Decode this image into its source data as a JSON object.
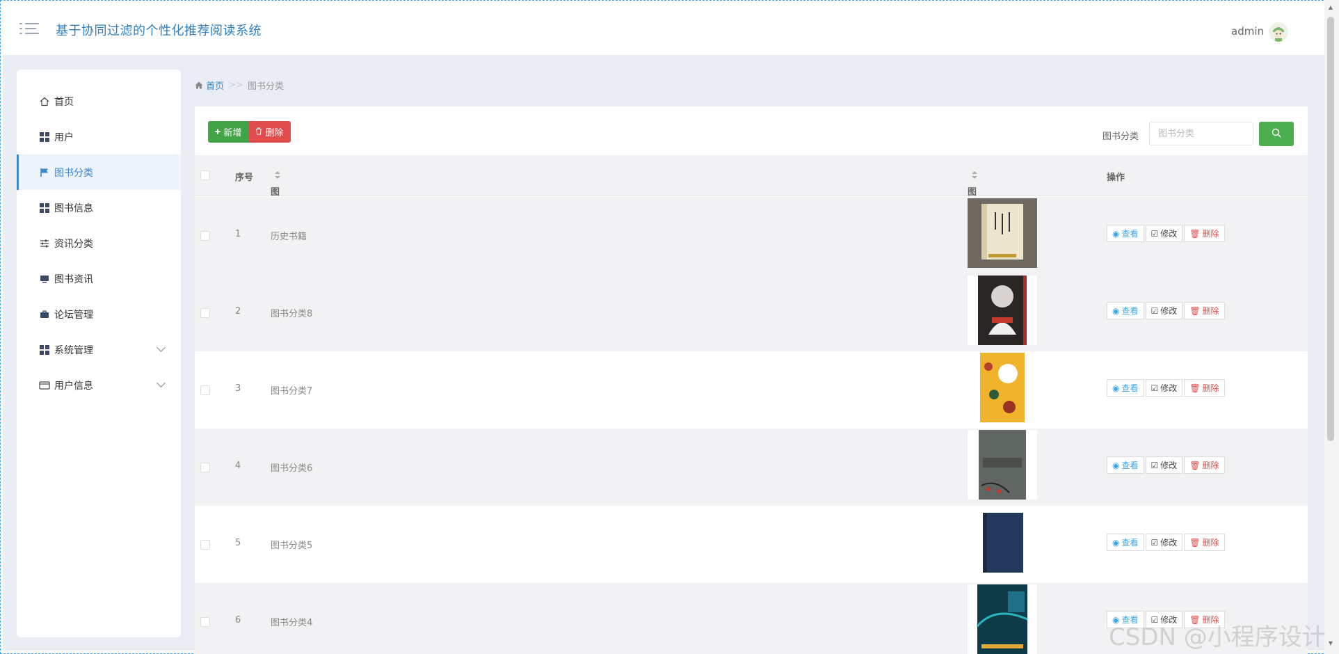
{
  "header": {
    "app_title": "基于协同过滤的个性化推荐阅读系统",
    "user_name": "admin",
    "menu_icon": "list-menu-icon",
    "avatar_icon": "avatar-icon"
  },
  "sidebar": {
    "items": [
      {
        "label": "首页",
        "icon": "home-icon",
        "active": false,
        "expandable": false
      },
      {
        "label": "用户",
        "icon": "grid-icon",
        "active": false,
        "expandable": false
      },
      {
        "label": "图书分类",
        "icon": "flag-icon",
        "active": true,
        "expandable": false
      },
      {
        "label": "图书信息",
        "icon": "grid-icon",
        "active": false,
        "expandable": false
      },
      {
        "label": "资讯分类",
        "icon": "sliders-icon",
        "active": false,
        "expandable": false
      },
      {
        "label": "图书资讯",
        "icon": "monitor-icon",
        "active": false,
        "expandable": false
      },
      {
        "label": "论坛管理",
        "icon": "briefcase-icon",
        "active": false,
        "expandable": false
      },
      {
        "label": "系统管理",
        "icon": "grid-icon",
        "active": false,
        "expandable": true
      },
      {
        "label": "用户信息",
        "icon": "card-icon",
        "active": false,
        "expandable": true
      }
    ]
  },
  "breadcrumb": {
    "home": "首页",
    "separator": ">>",
    "current": "图书分类"
  },
  "toolbar": {
    "add_label": "新增",
    "delete_label": "删除",
    "search_label": "图书分类",
    "search_placeholder": "图书分类",
    "search_value": ""
  },
  "table": {
    "columns": {
      "index": "序号",
      "category": "图书分类",
      "image": "图片",
      "actions": "操作"
    },
    "rows": [
      {
        "index": "1",
        "category": "历史书籍"
      },
      {
        "index": "2",
        "category": "图书分类8"
      },
      {
        "index": "3",
        "category": "图书分类7"
      },
      {
        "index": "4",
        "category": "图书分类6"
      },
      {
        "index": "5",
        "category": "图书分类5"
      },
      {
        "index": "6",
        "category": "图书分类4"
      }
    ],
    "actions": {
      "view": "查看",
      "edit": "修改",
      "delete": "删除"
    }
  },
  "watermark": "CSDN @小程序设计",
  "colors": {
    "accent": "#3b86c9",
    "add_button": "#43a447",
    "delete_button": "#e04b4b",
    "search_button": "#4cae4f"
  }
}
